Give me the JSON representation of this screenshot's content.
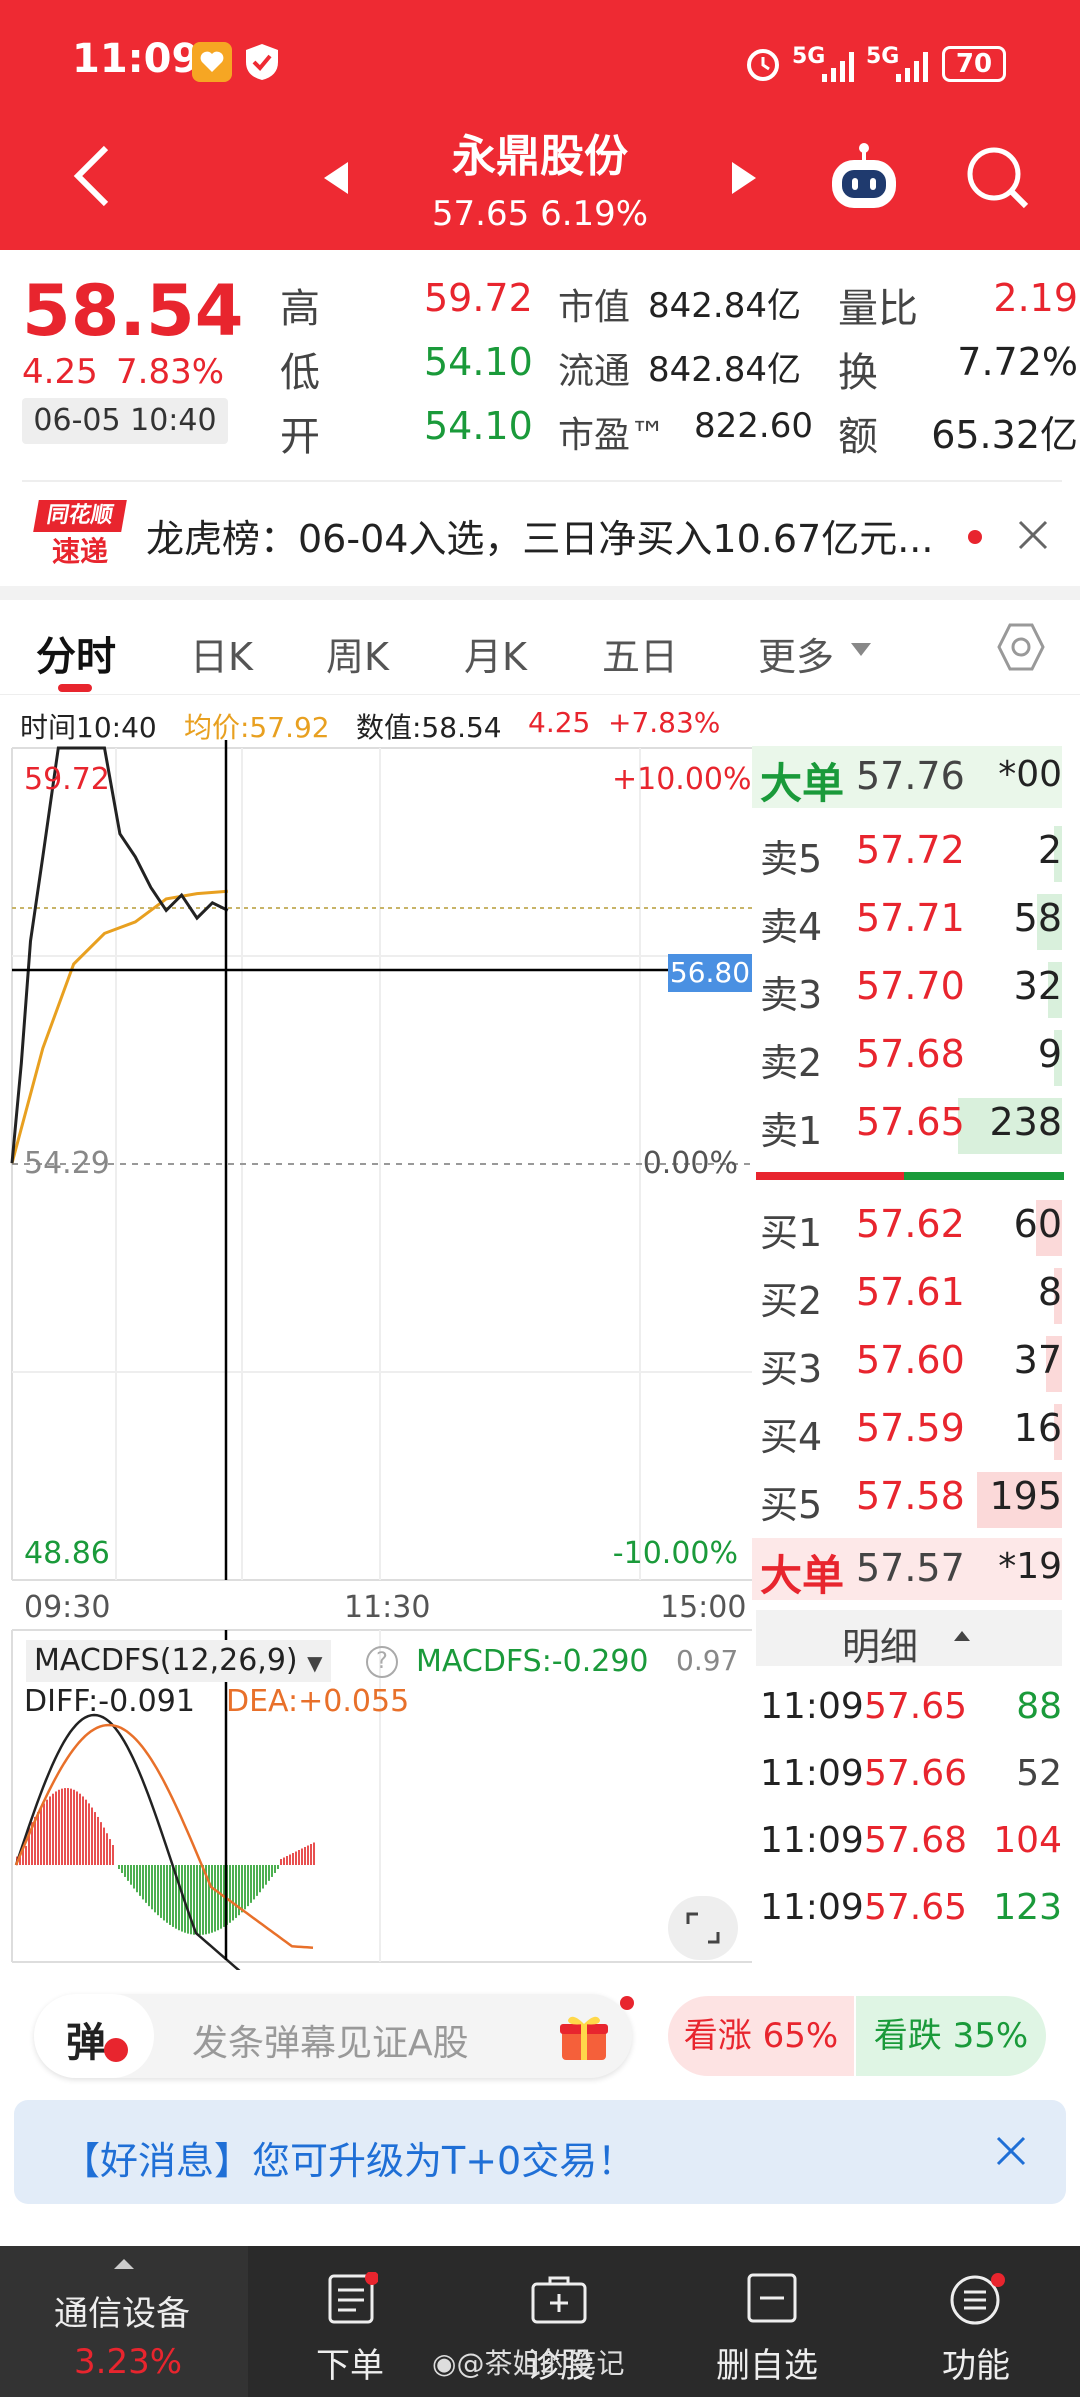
{
  "status_bar": {
    "time": "11:09",
    "signal1": "5G",
    "signal2": "5G",
    "battery": "70"
  },
  "header": {
    "title": "永鼎股份",
    "subtitle": "57.65 6.19%"
  },
  "quote": {
    "price": "58.54",
    "change": "4.25",
    "change_pct": "7.83%",
    "datetime": "06-05 10:40",
    "high_label": "高",
    "high": "59.72",
    "low_label": "低",
    "low": "54.10",
    "open_label": "开",
    "open": "54.10",
    "mktcap_label": "市值",
    "mktcap": "842.84亿",
    "float_label": "流通",
    "float_cap": "842.84亿",
    "pe_label": "市盈™",
    "pe": "822.60",
    "vol_ratio_label": "量比",
    "vol_ratio": "2.19",
    "turnover_label": "换",
    "turnover": "7.72%",
    "amount_label": "额",
    "amount": "65.32亿"
  },
  "news": {
    "logo_top": "同花顺",
    "logo_bottom": "速递",
    "text": "龙虎榜：06-04入选，三日净买入10.67亿元..."
  },
  "tabs": [
    "分时",
    "日K",
    "周K",
    "月K",
    "五日",
    "更多"
  ],
  "info_bar": {
    "time": "时间10:40",
    "avg": "均价:57.92",
    "value": "数值:58.54",
    "change": "4.25",
    "change_pct": "+7.83%"
  },
  "chart_axes": {
    "y_top": "59.72",
    "y_top_pct": "+10.00%",
    "y_mid": "54.29",
    "y_mid_pct": "0.00%",
    "y_bot": "48.86",
    "y_bot_pct": "-10.00%",
    "cursor_price": "56.80",
    "x_start": "09:30",
    "x_mid": "11:30",
    "x_end": "15:00"
  },
  "chart_data": {
    "type": "line",
    "x_label": "time",
    "ylim": [
      48.86,
      59.72
    ],
    "series": [
      {
        "name": "price",
        "x": [
          "09:30",
          "09:33",
          "09:36",
          "09:40",
          "09:45",
          "09:50",
          "09:55",
          "10:00",
          "10:05",
          "10:10",
          "10:15",
          "10:20",
          "10:25",
          "10:30",
          "10:35",
          "10:40"
        ],
        "values": [
          54.3,
          55.6,
          57.2,
          58.3,
          59.72,
          59.72,
          59.72,
          59.72,
          58.6,
          58.3,
          57.9,
          57.6,
          57.8,
          57.5,
          57.7,
          57.6
        ]
      },
      {
        "name": "avg",
        "x": [
          "09:30",
          "09:40",
          "09:50",
          "10:00",
          "10:10",
          "10:20",
          "10:30",
          "10:40"
        ],
        "values": [
          54.3,
          55.8,
          56.9,
          57.3,
          57.45,
          57.75,
          57.82,
          57.85
        ]
      }
    ]
  },
  "order_book": {
    "big_sell": {
      "label": "大单",
      "price": "57.76",
      "vol": "*00"
    },
    "asks": [
      {
        "label": "卖5",
        "price": "57.72",
        "vol": "2"
      },
      {
        "label": "卖4",
        "price": "57.71",
        "vol": "58"
      },
      {
        "label": "卖3",
        "price": "57.70",
        "vol": "32"
      },
      {
        "label": "卖2",
        "price": "57.68",
        "vol": "9"
      },
      {
        "label": "卖1",
        "price": "57.65",
        "vol": "238"
      }
    ],
    "bids": [
      {
        "label": "买1",
        "price": "57.62",
        "vol": "60"
      },
      {
        "label": "买2",
        "price": "57.61",
        "vol": "8"
      },
      {
        "label": "买3",
        "price": "57.60",
        "vol": "37"
      },
      {
        "label": "买4",
        "price": "57.59",
        "vol": "16"
      },
      {
        "label": "买5",
        "price": "57.58",
        "vol": "195"
      }
    ],
    "big_buy": {
      "label": "大单",
      "price": "57.57",
      "vol": "*19"
    }
  },
  "detail_toggle": "明细",
  "ticks": [
    {
      "time": "11:09",
      "price": "57.65",
      "vol": "88",
      "dir": "green"
    },
    {
      "time": "11:09",
      "price": "57.66",
      "vol": "52",
      "dir": "gray"
    },
    {
      "time": "11:09",
      "price": "57.68",
      "vol": "104",
      "dir": "red"
    },
    {
      "time": "11:09",
      "price": "57.65",
      "vol": "123",
      "dir": "green"
    }
  ],
  "macd": {
    "selector": "MACDFS(12,26,9)",
    "value": "MACDFS:-0.290",
    "diff": "DIFF:-0.091",
    "dea": "DEA:+0.055",
    "scale": "0.97"
  },
  "danmu": {
    "icon": "弹",
    "placeholder": "发条弹幕见证A股",
    "up": "看涨 65%",
    "down": "看跌 35%"
  },
  "banner": {
    "text": "【好消息】您可升级为T+0交易！"
  },
  "bottom_nav": {
    "sector": "通信设备",
    "sector_pct": "3.23%",
    "items": [
      "下单",
      "诊股",
      "删自选",
      "功能"
    ],
    "watermark": "@茶姐的笔记"
  },
  "colors": {
    "brand_red": "#ee2a33",
    "up_red": "#e8252e",
    "down_green": "#1a9a3a",
    "avg_line": "#e8a020",
    "cursor_blue": "#4a90e2"
  }
}
